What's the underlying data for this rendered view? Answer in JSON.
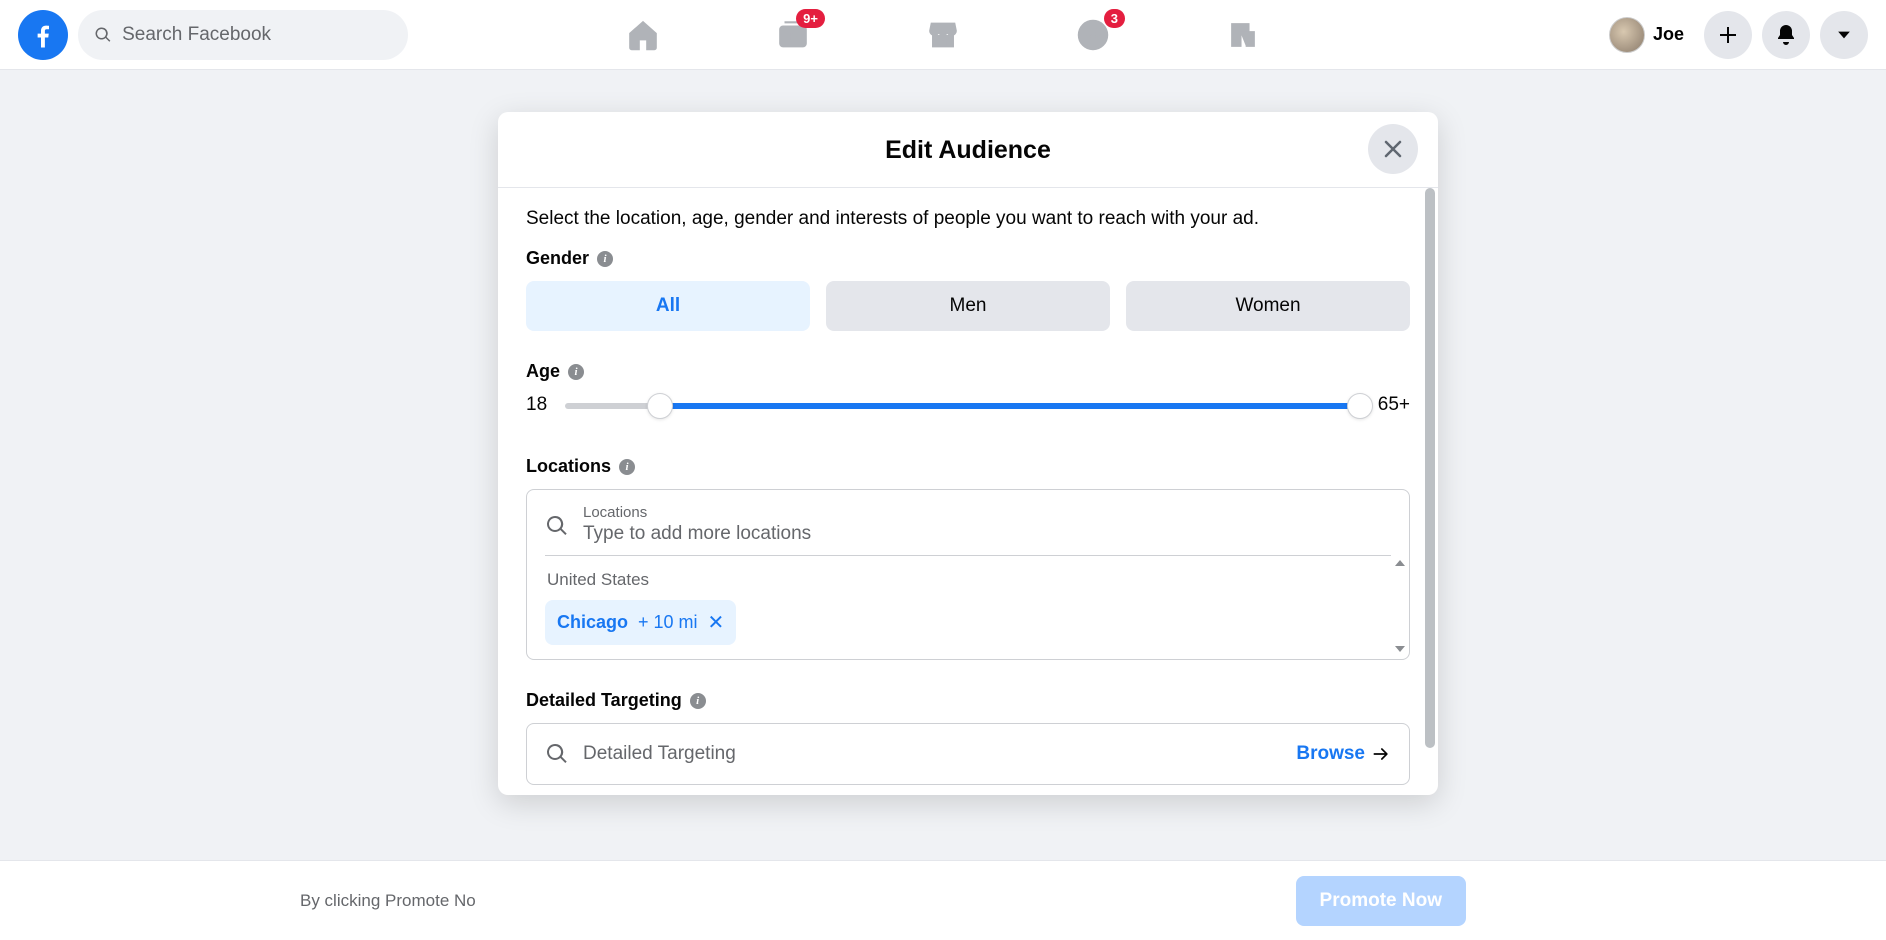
{
  "header": {
    "search_placeholder": "Search Facebook",
    "user_name": "Joe",
    "badges": {
      "watch": "9+",
      "groups": "3"
    }
  },
  "bottom": {
    "disclaimer_partial": "By clicking Promote No",
    "promote_button": "Promote Now"
  },
  "modal": {
    "title": "Edit Audience",
    "intro": "Select the location, age, gender and interests of people you want to reach with your ad.",
    "gender": {
      "label": "Gender",
      "options": [
        "All",
        "Men",
        "Women"
      ],
      "selected": "All"
    },
    "age": {
      "label": "Age",
      "min_label": "18",
      "max_label": "65+"
    },
    "locations": {
      "label": "Locations",
      "field_label": "Locations",
      "placeholder": "Type to add more locations",
      "country": "United States",
      "chip_name": "Chicago",
      "chip_radius": "+ 10 mi"
    },
    "detailed": {
      "label": "Detailed Targeting",
      "placeholder": "Detailed Targeting",
      "browse": "Browse"
    }
  }
}
